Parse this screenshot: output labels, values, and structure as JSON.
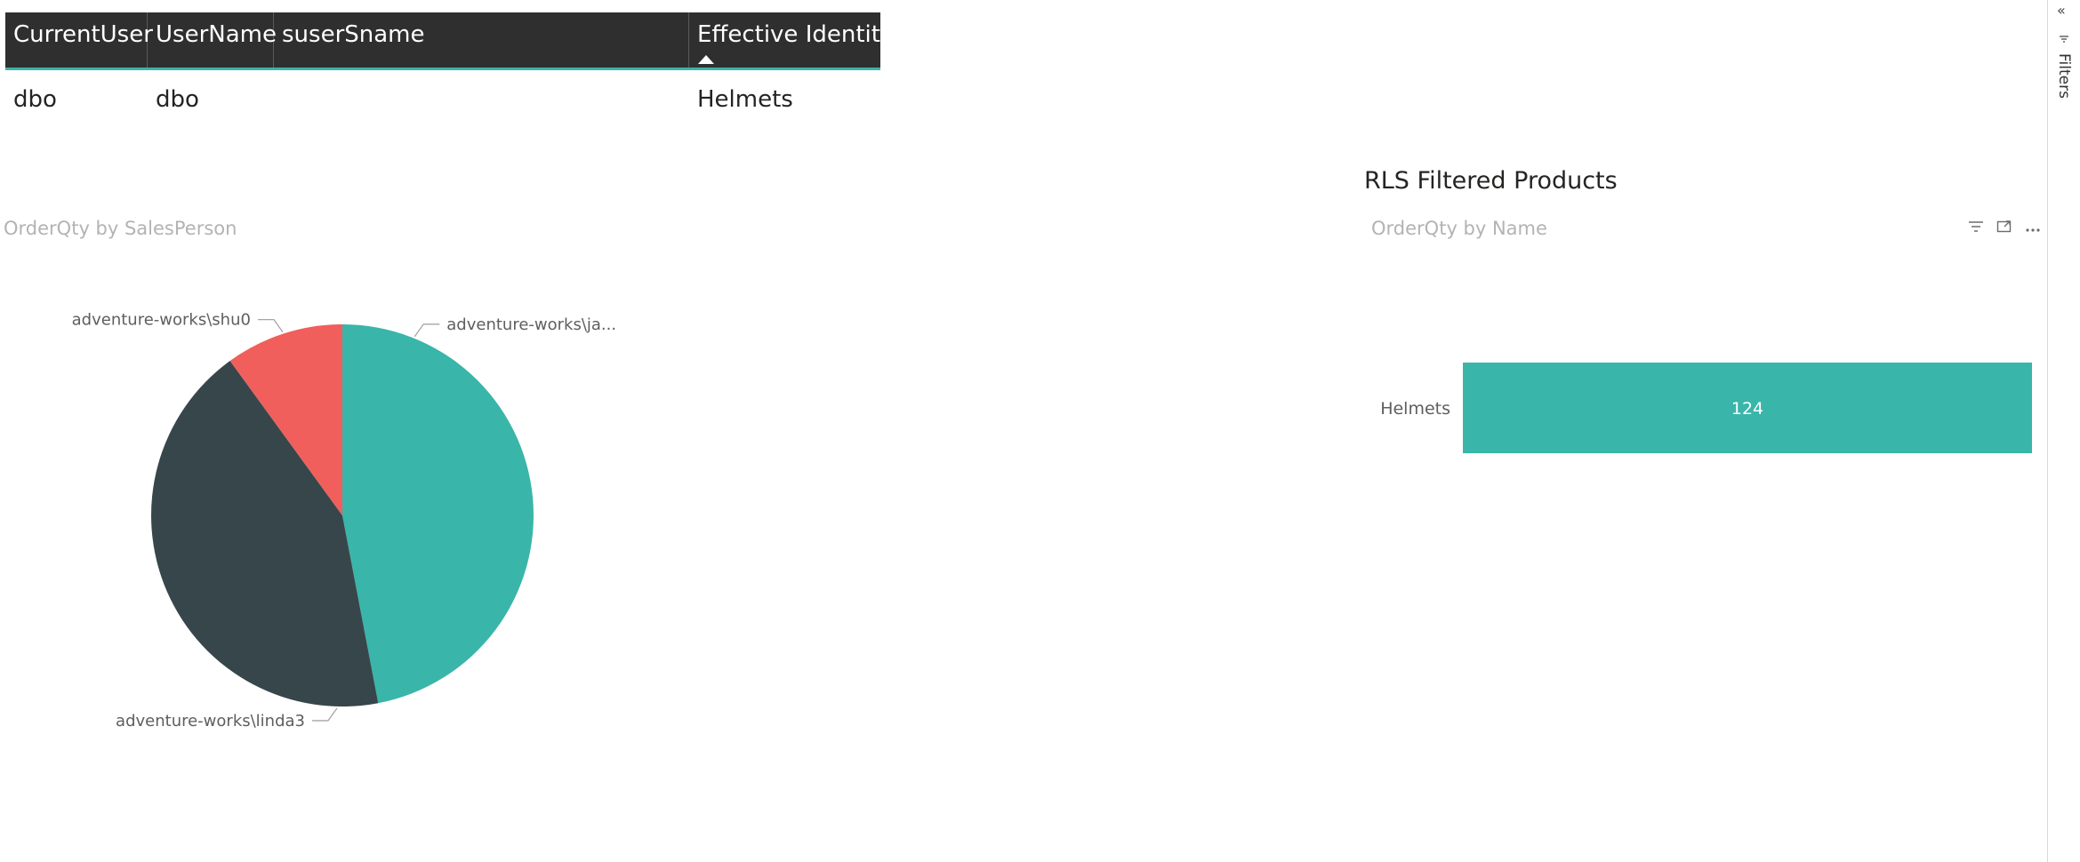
{
  "table": {
    "headers": [
      "CurrentUser",
      "UserName",
      "suserSname",
      "Effective Identity"
    ],
    "sort_column": "Effective Identity",
    "rows": [
      [
        "dbo",
        "dbo",
        "",
        "Helmets"
      ]
    ]
  },
  "pie_visual": {
    "title": "OrderQty by SalesPerson",
    "slice_labels": [
      "adventure-works\\ja...",
      "adventure-works\\linda3",
      "adventure-works\\shu0"
    ]
  },
  "bar_card": {
    "card_title": "RLS Filtered Products",
    "title": "OrderQty by Name"
  },
  "filters_pane": {
    "label": "Filters",
    "icons": [
      "collapse-icon",
      "filter-icon"
    ]
  },
  "visual_header_icons": [
    "filter-icon",
    "focus-mode-icon",
    "more-options-icon"
  ],
  "colors": {
    "teal": "#3ab5a9",
    "dark": "#37464b",
    "red": "#f05f5b",
    "header_bg": "#2f2f2f"
  },
  "chart_data": [
    {
      "type": "pie",
      "title": "OrderQty by SalesPerson",
      "categories": [
        "adventure-works\\ja...",
        "adventure-works\\linda3",
        "adventure-works\\shu0"
      ],
      "values": [
        47,
        43,
        10
      ],
      "colors": [
        "#3ab5a9",
        "#37464b",
        "#f05f5b"
      ]
    },
    {
      "type": "bar",
      "orientation": "horizontal",
      "title": "OrderQty by Name",
      "categories": [
        "Helmets"
      ],
      "values": [
        124
      ],
      "data_labels": [
        "124"
      ],
      "xlim": [
        0,
        124
      ],
      "color": "#3ab5a9"
    }
  ]
}
